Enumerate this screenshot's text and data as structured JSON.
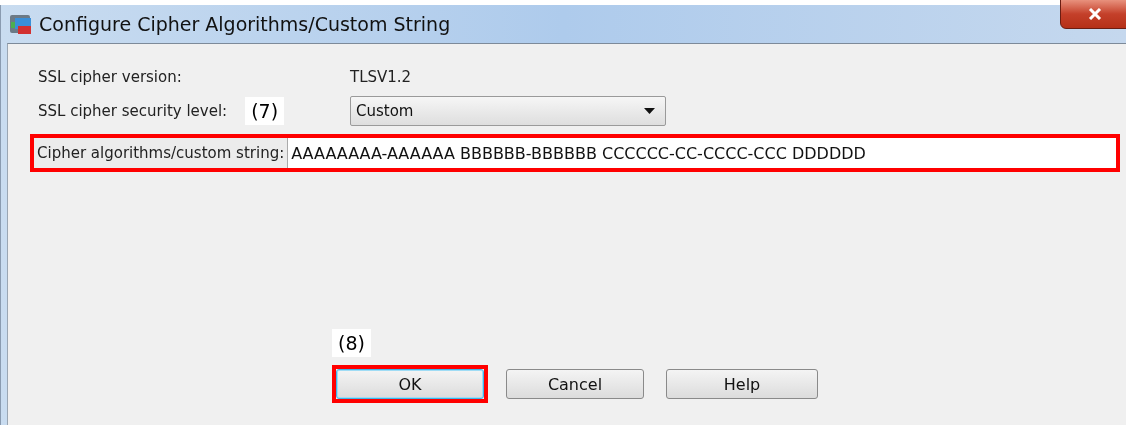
{
  "window": {
    "title": "Configure Cipher Algorithms/Custom String"
  },
  "fields": [
    {
      "kind": "text",
      "label": "SSL cipher version:",
      "value": "TLSV1.2"
    },
    {
      "kind": "dropdown",
      "label": "SSL cipher security level:",
      "value": "Custom",
      "callout": "(7)"
    },
    {
      "kind": "input",
      "label": "Cipher algorithms/custom string:",
      "value": "AAAAAAAA-AAAAAA BBBBBB-BBBBBB CCCCCC-CC-CCCC-CCC DDDDDD",
      "highlighted": true
    }
  ],
  "buttons": [
    {
      "label": "OK",
      "focused": true,
      "highlighted": true,
      "callout": "(8)"
    },
    {
      "label": "Cancel",
      "focused": false,
      "highlighted": false
    },
    {
      "label": "Help",
      "focused": false,
      "highlighted": false
    }
  ]
}
